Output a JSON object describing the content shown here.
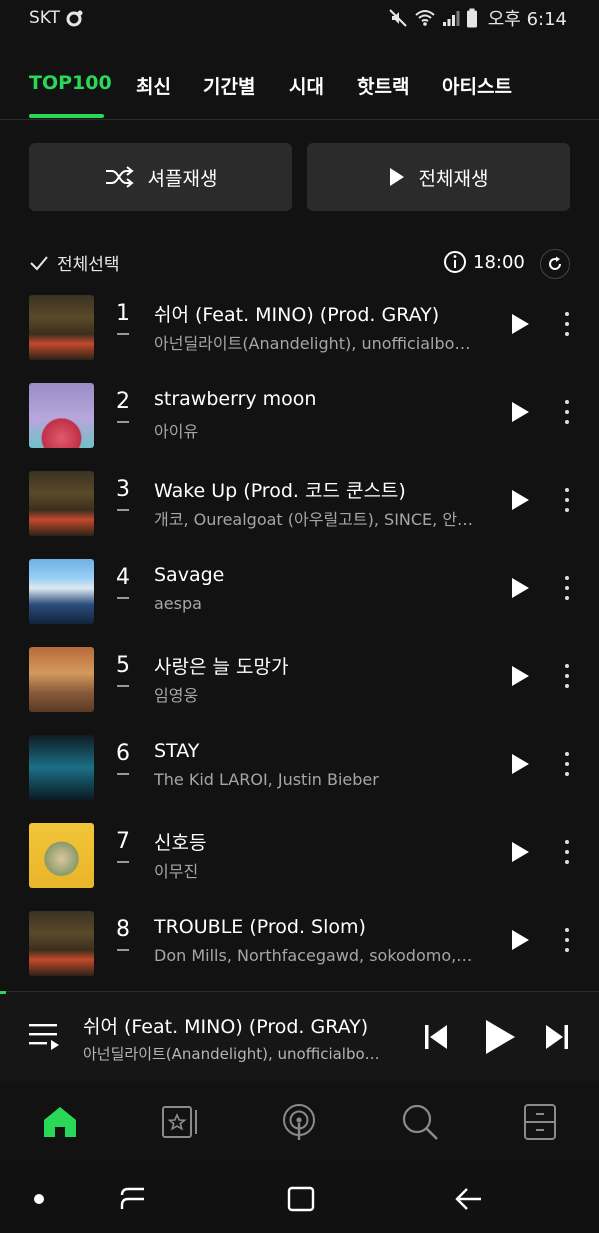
{
  "status": {
    "carrier": "SKT",
    "time": "오후 6:14"
  },
  "tabs": [
    {
      "label": "TOP100",
      "active": true
    },
    {
      "label": "최신",
      "active": false
    },
    {
      "label": "기간별",
      "active": false
    },
    {
      "label": "시대",
      "active": false
    },
    {
      "label": "핫트랙",
      "active": false
    },
    {
      "label": "아티스트",
      "active": false
    }
  ],
  "actions": {
    "shuffle_label": "셔플재생",
    "play_all_label": "전체재생"
  },
  "list_header": {
    "select_all_label": "전체선택",
    "updated_time": "18:00"
  },
  "songs": [
    {
      "rank": "1",
      "title": "쉬어 (Feat. MINO) (Prod. GRAY)",
      "artist": "아넌딜라이트(Anandelight), unofficialbo…",
      "cover": "smtm"
    },
    {
      "rank": "2",
      "title": "strawberry moon",
      "artist": "아이유",
      "cover": "strawberry"
    },
    {
      "rank": "3",
      "title": "Wake Up (Prod. 코드 쿤스트)",
      "artist": "개코, Ourealgoat (아우릴고트), SINCE, 안…",
      "cover": "smtm"
    },
    {
      "rank": "4",
      "title": "Savage",
      "artist": "aespa",
      "cover": "savage"
    },
    {
      "rank": "5",
      "title": "사랑은 늘 도망가",
      "artist": "임영웅",
      "cover": "warm"
    },
    {
      "rank": "6",
      "title": "STAY",
      "artist": "The Kid LAROI, Justin Bieber",
      "cover": "stay"
    },
    {
      "rank": "7",
      "title": "신호등",
      "artist": "이무진",
      "cover": "yellow"
    },
    {
      "rank": "8",
      "title": "TROUBLE (Prod. Slom)",
      "artist": "Don Mills, Northfacegawd, sokodomo,…",
      "cover": "smtm"
    }
  ],
  "now_playing": {
    "title": "쉬어 (Feat. MINO) (Prod. GRAY)",
    "artist": "아넌딜라이트(Anandelight), unofficialbo…",
    "progress": 0.005
  },
  "colors": {
    "accent": "#2ad858",
    "background": "#121212",
    "button": "#2b2b2b",
    "muted_text": "#a6a6a6"
  },
  "bottom_nav": [
    "home-icon",
    "library-icon",
    "podcast-icon",
    "search-icon",
    "more-menu-icon"
  ]
}
